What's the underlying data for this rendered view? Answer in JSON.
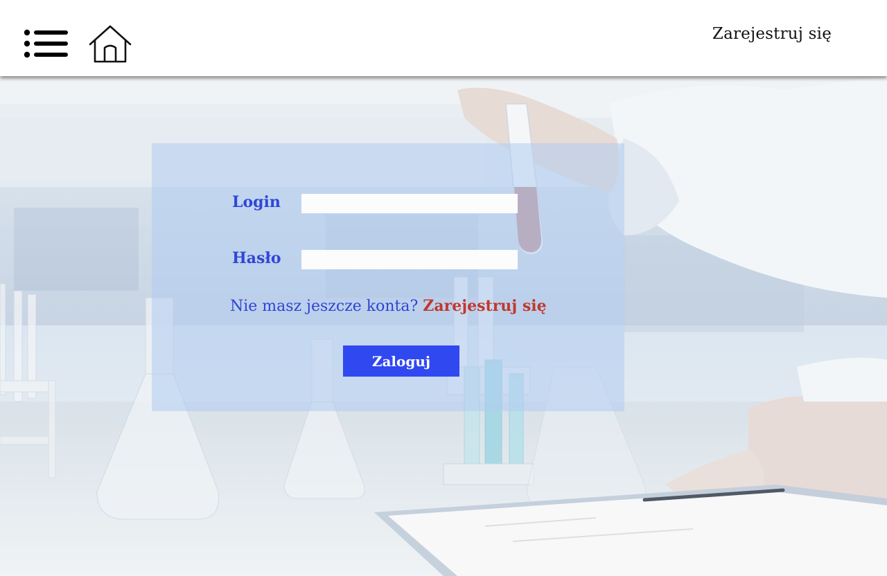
{
  "header": {
    "menu_icon": "list-menu-icon",
    "home_icon": "home-icon",
    "register_label": "Zarejestruj się"
  },
  "login_form": {
    "login_label": "Login",
    "login_value": "",
    "password_label": "Hasło",
    "password_value": "",
    "no_account_text": "Nie masz jeszcze konta?",
    "signup_link_label": "Zarejestruj się",
    "submit_label": "Zaloguj"
  },
  "colors": {
    "accent": "#3048f0",
    "label_blue": "#3046d8",
    "signup_red": "#c0392f",
    "panel_tint": "#b0ccf0",
    "header_bg": "#ffffff"
  },
  "background": {
    "scene": "laboratory-scientist-test-tube"
  }
}
